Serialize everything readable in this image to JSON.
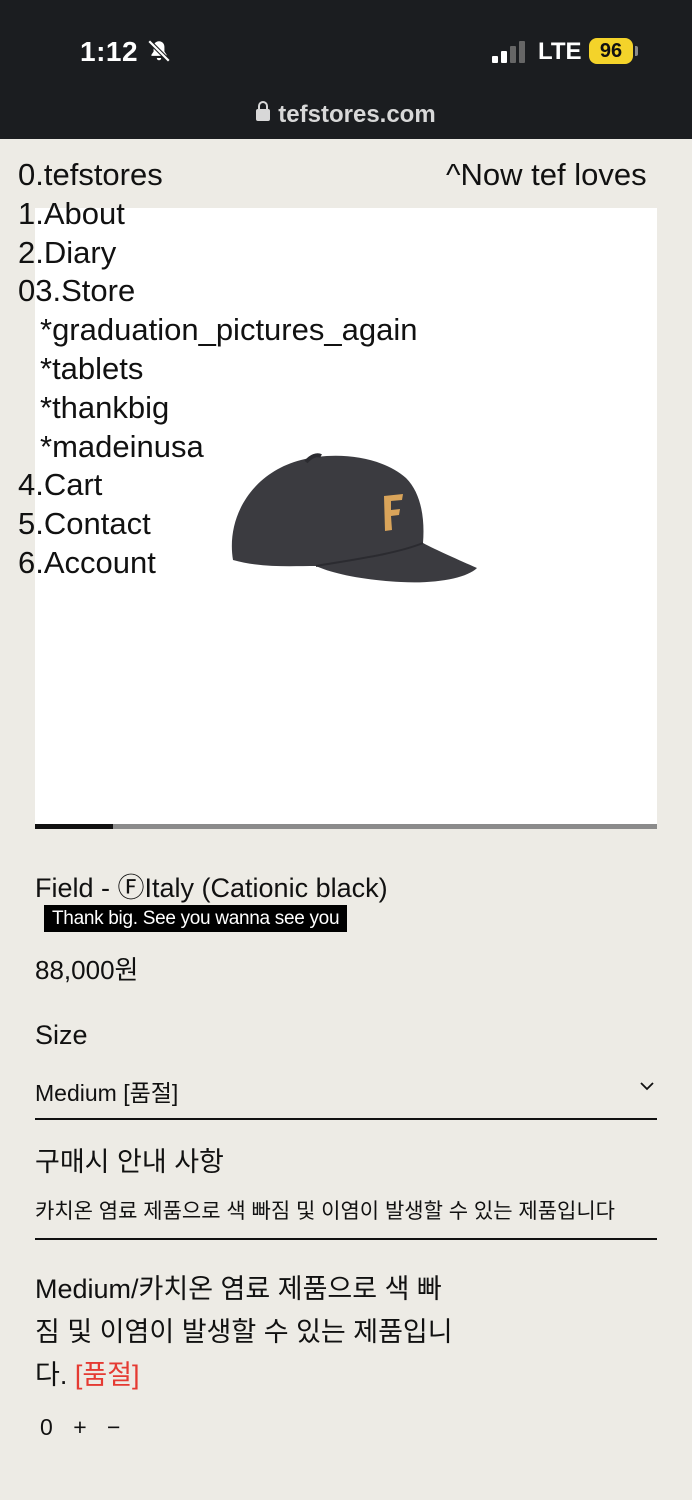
{
  "status_bar": {
    "time": "1:12",
    "network": "LTE",
    "battery": "96"
  },
  "browser": {
    "url": "tefstores.com"
  },
  "marquee": "^Now tef loves",
  "nav": {
    "items": [
      {
        "label": "0.tefstores",
        "sub": false
      },
      {
        "label": "1.About",
        "sub": false
      },
      {
        "label": "2.Diary",
        "sub": false
      },
      {
        "label": "03.Store",
        "sub": false
      },
      {
        "label": "*graduation_pictures_again",
        "sub": true
      },
      {
        "label": "*tablets",
        "sub": true
      },
      {
        "label": "*thankbig",
        "sub": true
      },
      {
        "label": "*madeinusa",
        "sub": true
      },
      {
        "label": "4.Cart",
        "sub": false
      },
      {
        "label": "5.Contact",
        "sub": false
      },
      {
        "label": "6.Account",
        "sub": false
      }
    ]
  },
  "gallery": {
    "active_fraction": 0.125
  },
  "product": {
    "title": "Field - ⒻItaly (Cationic black)",
    "notice": "Thank big. See you wanna see you",
    "price": "88,000원",
    "size_label": "Size",
    "size_value": "Medium [품절]",
    "guide_label": "구매시 안내 사항",
    "guide_value": "카치온 염료 제품으로 색 빠짐 및 이염이 발생할 수 있는 제품입니다",
    "option_text": "Medium/카치온 염료 제품으로 색 빠짐 및 이염이 발생할 수 있는 제품입니다.",
    "option_status": "[품절]",
    "quantity": "0",
    "plus": "+",
    "minus": "−"
  },
  "colors": {
    "background": "#edebe5",
    "sold_out": "#e53a32",
    "battery": "#f4d32a",
    "cap_body": "#3b3b40",
    "cap_logo": "#d9a45a"
  },
  "icons": [
    "bell-slash-icon",
    "signal-icon",
    "lock-icon",
    "chevron-down-icon"
  ]
}
